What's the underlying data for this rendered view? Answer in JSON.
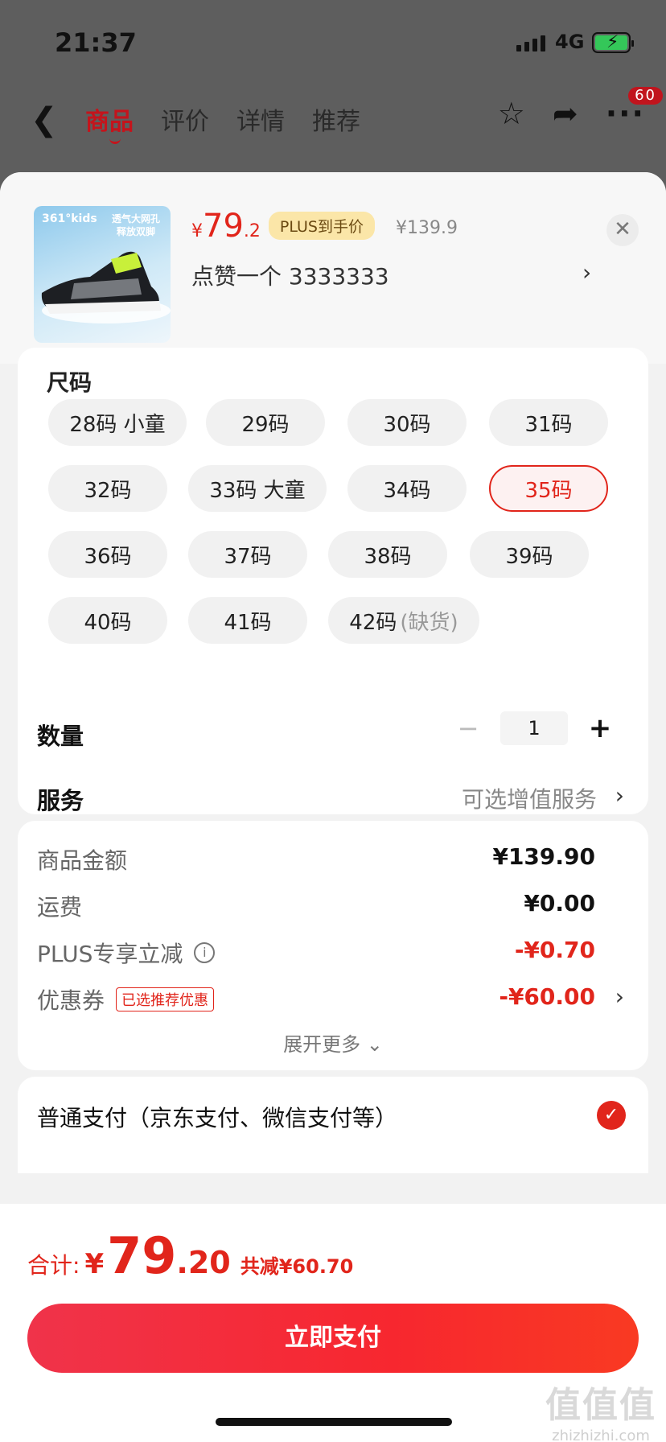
{
  "status_bar": {
    "time": "21:37",
    "network": "4G"
  },
  "nav": {
    "tabs": [
      "商品",
      "评价",
      "详情",
      "推荐"
    ],
    "active_tab": 0,
    "badge_count": "60"
  },
  "product": {
    "price_currency": "¥",
    "price_int": "79",
    "price_dec": ".2",
    "plus_label": "PLUS到手价",
    "original_price": "¥139.9",
    "selected_spec": "点赞一个  3333333",
    "image_brand": "361°kids",
    "image_slogan": "透气大网孔 释放双脚"
  },
  "spec": {
    "title": "尺码",
    "sizes": [
      {
        "label": "28码 小童"
      },
      {
        "label": "29码"
      },
      {
        "label": "30码"
      },
      {
        "label": "31码"
      },
      {
        "label": "32码"
      },
      {
        "label": "33码 大童"
      },
      {
        "label": "34码"
      },
      {
        "label": "35码"
      },
      {
        "label": "36码"
      },
      {
        "label": "37码"
      },
      {
        "label": "38码"
      },
      {
        "label": "39码"
      },
      {
        "label": "40码"
      },
      {
        "label": "41码"
      },
      {
        "label": "42码"
      }
    ],
    "out_of_stock_note": "(缺货)",
    "selected_size": "35码"
  },
  "quantity": {
    "label": "数量",
    "minus": "−",
    "value": "1",
    "plus": "+"
  },
  "service": {
    "label": "服务",
    "value": "可选增值服务",
    "arrow": "›"
  },
  "amounts": {
    "rows": [
      {
        "label": "商品金额",
        "value": "¥139.90"
      },
      {
        "label": "运费",
        "value": "¥0.00"
      },
      {
        "label": "PLUS专享立减",
        "value": "-¥0.70"
      },
      {
        "label": "优惠券",
        "tag": "已选推荐优惠",
        "value": "-¥60.00"
      }
    ],
    "info_icon": "i",
    "expand": "展开更多 ⌄"
  },
  "payment": {
    "label": "普通支付（京东支付、微信支付等）",
    "check": "✓"
  },
  "footer": {
    "total_label": "合计:",
    "total_currency": "¥",
    "total_int": "79",
    "total_dec": ".20",
    "saving": "共减¥60.70",
    "pay_button": "立即支付"
  },
  "watermark": {
    "big": "值值值",
    "small": "zhizhizhi.com"
  },
  "colors": {
    "accent": "#e1251b",
    "plus_tag_bg": "#fbe6a8",
    "overlay": "#5e5e5e"
  },
  "icons": {
    "back": "chevron-left-icon",
    "favorite": "star-icon",
    "share": "share-icon",
    "more": "more-icon",
    "close": "close-icon",
    "check": "check-icon"
  }
}
